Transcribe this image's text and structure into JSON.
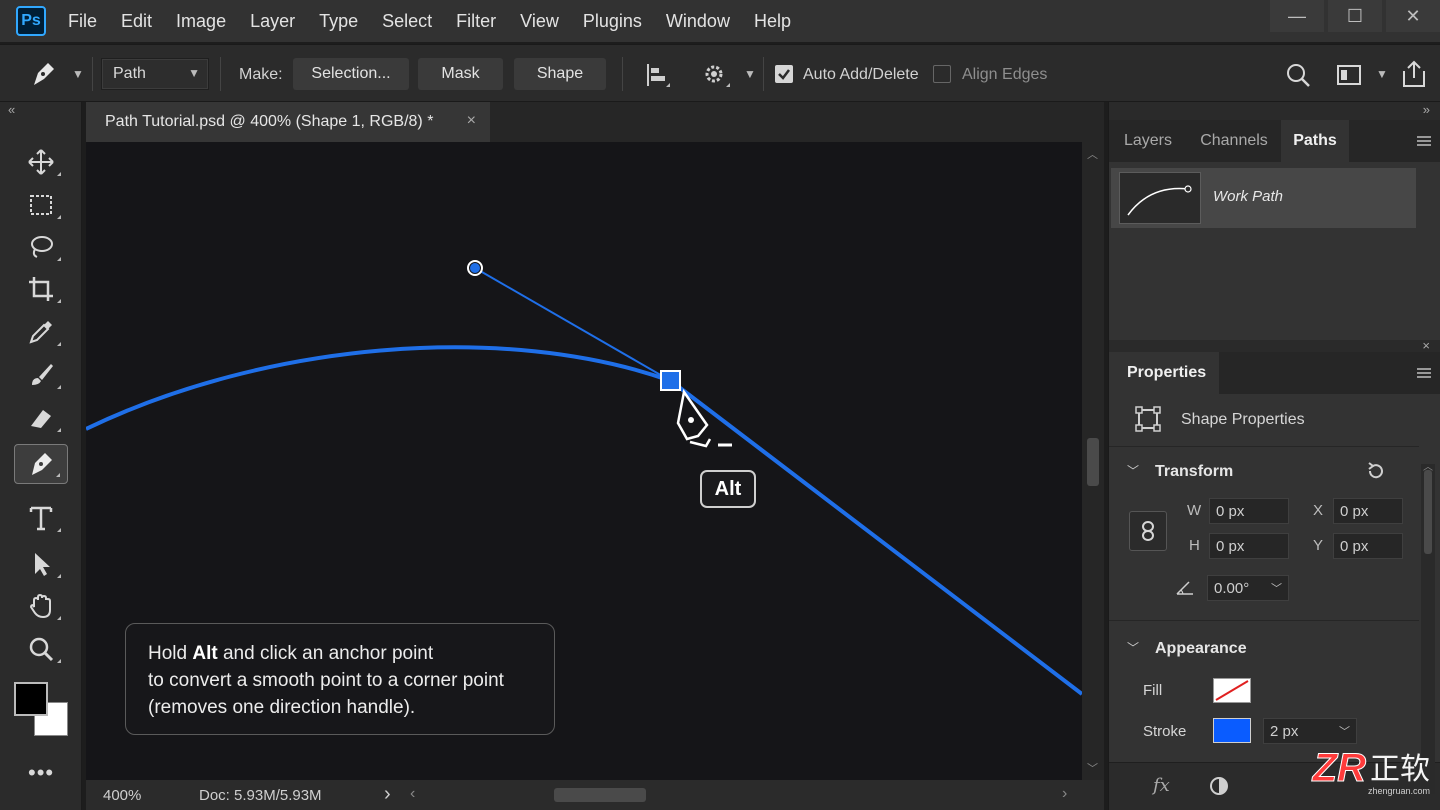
{
  "app": {
    "logo": "Ps",
    "accent_color": "#31a8ff"
  },
  "menu": [
    "File",
    "Edit",
    "Image",
    "Layer",
    "Type",
    "Select",
    "Filter",
    "View",
    "Plugins",
    "Window",
    "Help"
  ],
  "window_controls": {
    "minimize": "—",
    "maximize": "☐",
    "close": "✕"
  },
  "options_bar": {
    "mode_select": "Path",
    "make_label": "Make:",
    "selection_button": "Selection...",
    "mask_button": "Mask",
    "shape_button": "Shape",
    "auto_add_delete": {
      "label": "Auto Add/Delete",
      "checked": true
    },
    "align_edges": {
      "label": "Align Edges",
      "checked": false
    }
  },
  "document_tab": {
    "title": "Path Tutorial.psd @ 400% (Shape 1, RGB/8) *",
    "close": "×"
  },
  "canvas": {
    "path_color": "#1f6fe8",
    "alt_key_label": "Alt",
    "hint": {
      "line1_pre": "Hold ",
      "line1_bold": "Alt",
      "line1_post": " and click an anchor point",
      "line2": "to convert a smooth point to a corner point",
      "line3": "(removes one direction handle)."
    }
  },
  "status_bar": {
    "zoom": "400%",
    "doc": "Doc: 5.93M/5.93M",
    "arrow": "›"
  },
  "panels": {
    "tabs": [
      "Layers",
      "Channels",
      "Paths"
    ],
    "active_tab": "Paths",
    "paths": [
      {
        "name": "Work Path"
      }
    ],
    "properties": {
      "tab": "Properties",
      "subtitle": "Shape Properties",
      "transform": {
        "title": "Transform",
        "w_label": "W",
        "w_value": "0 px",
        "h_label": "H",
        "h_value": "0 px",
        "x_label": "X",
        "x_value": "0 px",
        "y_label": "Y",
        "y_value": "0 px",
        "angle_value": "0.00°"
      },
      "appearance": {
        "title": "Appearance",
        "fill_label": "Fill",
        "stroke_label": "Stroke",
        "stroke_color": "#0a5cff",
        "stroke_width": "2 px"
      },
      "footer": {
        "fx": "fx"
      }
    }
  },
  "watermark": {
    "logo": "ZR",
    "cn": "正软",
    "site": "zhengruan.com"
  }
}
